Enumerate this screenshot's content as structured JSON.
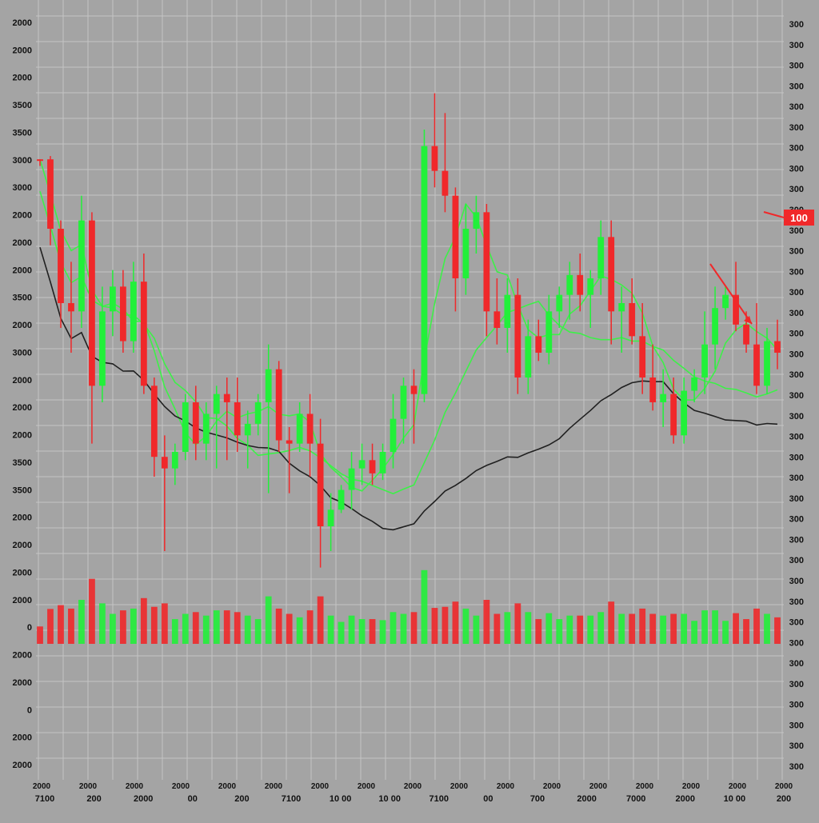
{
  "chart_data": {
    "type": "candlestick",
    "grid": true,
    "background": "#a4a4a4",
    "colors": {
      "up": "#22f03a",
      "down": "#f0282a",
      "grid": "#c4c4c4",
      "ma_green": "#3df048",
      "ma_dark": "#202020",
      "badge": "#f0282a"
    },
    "price_label": "100",
    "left_axis_labels": [
      "2000",
      "2000",
      "2000",
      "3500",
      "3500",
      "3000",
      "3000",
      "2000",
      "2000",
      "2000",
      "3500",
      "2000",
      "3000",
      "2000",
      "2000",
      "2000",
      "3500",
      "3500",
      "2000",
      "2000",
      "2000",
      "2000",
      "0",
      "2000",
      "2000",
      "0",
      "2000",
      "2000"
    ],
    "right_axis_labels": [
      "300",
      "300",
      "300",
      "300",
      "300",
      "300",
      "300",
      "300",
      "300",
      "300",
      "300",
      "300",
      "300",
      "300",
      "300",
      "300",
      "300",
      "300",
      "300",
      "300",
      "300",
      "300",
      "300",
      "300",
      "300",
      "300",
      "300",
      "300",
      "300",
      "300",
      "300",
      "300",
      "300",
      "300",
      "300",
      "300",
      "300"
    ],
    "x_labels_top": [
      "2000",
      "2000",
      "2000",
      "2000",
      "2000",
      "2000",
      "2000",
      "2000",
      "2000",
      "2000",
      "2000",
      "2000",
      "2000",
      "2000",
      "2000",
      "2000",
      "2000"
    ],
    "x_labels_bottom": [
      "7100",
      "200",
      "2000",
      "00",
      "200",
      "7100",
      "10 00",
      "10 00",
      "7100",
      "00",
      "700",
      "2000",
      "7000",
      "2000",
      "10 00",
      "200"
    ],
    "candles": [
      {
        "o": 158,
        "h": 158,
        "l": 162,
        "c": 158
      },
      {
        "o": 158,
        "h": 156,
        "l": 210,
        "c": 200
      },
      {
        "o": 200,
        "h": 195,
        "l": 260,
        "c": 245
      },
      {
        "o": 245,
        "h": 220,
        "l": 275,
        "c": 250
      },
      {
        "o": 250,
        "h": 180,
        "l": 260,
        "c": 195
      },
      {
        "o": 195,
        "h": 190,
        "l": 330,
        "c": 295
      },
      {
        "o": 295,
        "h": 235,
        "l": 305,
        "c": 250
      },
      {
        "o": 250,
        "h": 225,
        "l": 265,
        "c": 235
      },
      {
        "o": 235,
        "h": 225,
        "l": 275,
        "c": 268
      },
      {
        "o": 268,
        "h": 220,
        "l": 275,
        "c": 232
      },
      {
        "o": 232,
        "h": 215,
        "l": 300,
        "c": 295
      },
      {
        "o": 295,
        "h": 290,
        "l": 350,
        "c": 338
      },
      {
        "o": 338,
        "h": 325,
        "l": 395,
        "c": 345
      },
      {
        "o": 345,
        "h": 330,
        "l": 355,
        "c": 335
      },
      {
        "o": 335,
        "h": 300,
        "l": 340,
        "c": 305
      },
      {
        "o": 305,
        "h": 295,
        "l": 340,
        "c": 330
      },
      {
        "o": 330,
        "h": 305,
        "l": 340,
        "c": 312
      },
      {
        "o": 312,
        "h": 295,
        "l": 345,
        "c": 300
      },
      {
        "o": 300,
        "h": 290,
        "l": 340,
        "c": 305
      },
      {
        "o": 305,
        "h": 290,
        "l": 335,
        "c": 325
      },
      {
        "o": 325,
        "h": 310,
        "l": 345,
        "c": 318
      },
      {
        "o": 318,
        "h": 300,
        "l": 325,
        "c": 305
      },
      {
        "o": 305,
        "h": 270,
        "l": 360,
        "c": 285
      },
      {
        "o": 285,
        "h": 280,
        "l": 335,
        "c": 328
      },
      {
        "o": 328,
        "h": 320,
        "l": 360,
        "c": 330
      },
      {
        "o": 330,
        "h": 305,
        "l": 335,
        "c": 312
      },
      {
        "o": 312,
        "h": 300,
        "l": 350,
        "c": 330
      },
      {
        "o": 330,
        "h": 315,
        "l": 405,
        "c": 380
      },
      {
        "o": 380,
        "h": 360,
        "l": 395,
        "c": 370
      },
      {
        "o": 370,
        "h": 355,
        "l": 372,
        "c": 358
      },
      {
        "o": 358,
        "h": 335,
        "l": 370,
        "c": 345
      },
      {
        "o": 345,
        "h": 330,
        "l": 355,
        "c": 340
      },
      {
        "o": 340,
        "h": 330,
        "l": 355,
        "c": 348
      },
      {
        "o": 348,
        "h": 330,
        "l": 352,
        "c": 335
      },
      {
        "o": 335,
        "h": 300,
        "l": 345,
        "c": 315
      },
      {
        "o": 315,
        "h": 290,
        "l": 330,
        "c": 295
      },
      {
        "o": 295,
        "h": 285,
        "l": 330,
        "c": 300
      },
      {
        "o": 300,
        "h": 140,
        "l": 305,
        "c": 150
      },
      {
        "o": 150,
        "h": 118,
        "l": 175,
        "c": 165
      },
      {
        "o": 165,
        "h": 130,
        "l": 190,
        "c": 180
      },
      {
        "o": 180,
        "h": 175,
        "l": 250,
        "c": 230
      },
      {
        "o": 230,
        "h": 185,
        "l": 240,
        "c": 200
      },
      {
        "o": 200,
        "h": 180,
        "l": 215,
        "c": 190
      },
      {
        "o": 190,
        "h": 185,
        "l": 265,
        "c": 250
      },
      {
        "o": 250,
        "h": 230,
        "l": 270,
        "c": 260
      },
      {
        "o": 260,
        "h": 230,
        "l": 275,
        "c": 240
      },
      {
        "o": 240,
        "h": 230,
        "l": 300,
        "c": 290
      },
      {
        "o": 290,
        "h": 255,
        "l": 300,
        "c": 265
      },
      {
        "o": 265,
        "h": 255,
        "l": 280,
        "c": 275
      },
      {
        "o": 275,
        "h": 240,
        "l": 282,
        "c": 250
      },
      {
        "o": 250,
        "h": 235,
        "l": 260,
        "c": 240
      },
      {
        "o": 240,
        "h": 220,
        "l": 255,
        "c": 228
      },
      {
        "o": 228,
        "h": 215,
        "l": 250,
        "c": 240
      },
      {
        "o": 240,
        "h": 225,
        "l": 260,
        "c": 230
      },
      {
        "o": 230,
        "h": 195,
        "l": 240,
        "c": 205
      },
      {
        "o": 205,
        "h": 195,
        "l": 270,
        "c": 250
      },
      {
        "o": 250,
        "h": 235,
        "l": 275,
        "c": 245
      },
      {
        "o": 245,
        "h": 230,
        "l": 270,
        "c": 265
      },
      {
        "o": 265,
        "h": 245,
        "l": 300,
        "c": 290
      },
      {
        "o": 290,
        "h": 270,
        "l": 310,
        "c": 305
      },
      {
        "o": 305,
        "h": 285,
        "l": 320,
        "c": 300
      },
      {
        "o": 300,
        "h": 290,
        "l": 330,
        "c": 325
      },
      {
        "o": 325,
        "h": 290,
        "l": 330,
        "c": 298
      },
      {
        "o": 298,
        "h": 285,
        "l": 305,
        "c": 290
      },
      {
        "o": 290,
        "h": 250,
        "l": 300,
        "c": 270
      },
      {
        "o": 270,
        "h": 235,
        "l": 285,
        "c": 248
      },
      {
        "o": 248,
        "h": 235,
        "l": 255,
        "c": 240
      },
      {
        "o": 240,
        "h": 220,
        "l": 262,
        "c": 258
      },
      {
        "o": 258,
        "h": 250,
        "l": 275,
        "c": 270
      },
      {
        "o": 270,
        "h": 245,
        "l": 300,
        "c": 295
      },
      {
        "o": 295,
        "h": 260,
        "l": 300,
        "c": 268
      },
      {
        "o": 268,
        "h": 255,
        "l": 285,
        "c": 275
      }
    ]
  }
}
